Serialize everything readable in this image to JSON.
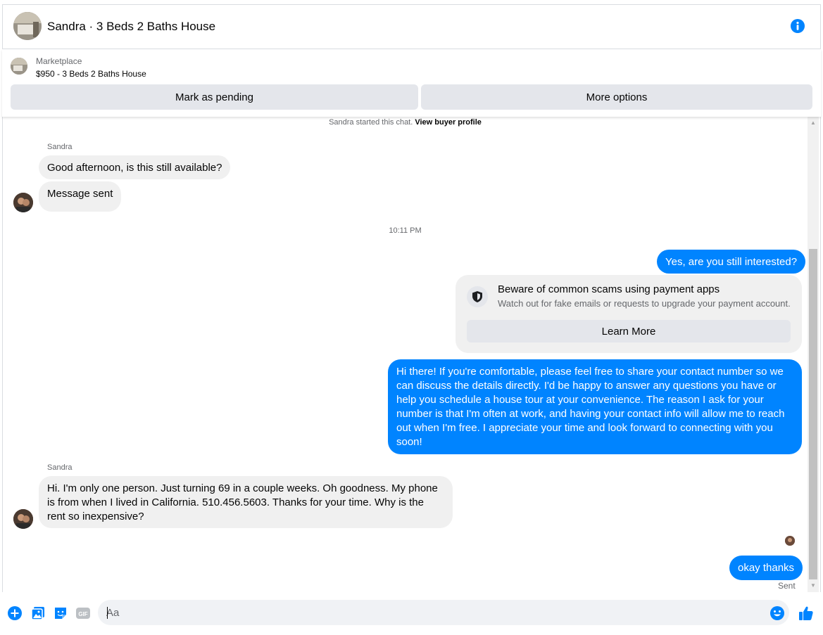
{
  "header": {
    "title": "Sandra · 3 Beds 2 Baths House",
    "info_icon": "info-icon"
  },
  "marketplace": {
    "source": "Marketplace",
    "item": "$950 - 3 Beds 2 Baths House",
    "mark_pending_label": "Mark as pending",
    "more_options_label": "More options"
  },
  "thread": {
    "system_note": "Sandra started this chat.",
    "system_link": "View buyer profile",
    "timestamp": "10:11 PM",
    "messages": [
      {
        "sender": "Sandra",
        "text": "Good afternoon, is this still available?"
      },
      {
        "sender": "Sandra",
        "text": "Message sent"
      },
      {
        "sender": "me",
        "text": "Yes, are you still interested?"
      },
      {
        "sender": "me",
        "text": "Hi there! If you're comfortable, please feel free to share your contact number so we can discuss the details directly. I'd be happy to answer any questions you have or help you schedule a house tour at your convenience. The reason I ask for your number is that I'm often at work, and having your contact info will allow me to reach out when I'm free. I appreciate your time and look forward to connecting with you soon!"
      },
      {
        "sender": "Sandra",
        "text": "Hi. I'm only one person. Just turning 69 in a couple weeks.  Oh goodness. My phone is from when I lived in California. 510.456.5603. Thanks for your time. Why is the rent so inexpensive?"
      },
      {
        "sender": "me",
        "text": "okay thanks"
      }
    ],
    "sender_name_1": "Sandra",
    "sender_name_2": "Sandra",
    "scam_card": {
      "title": "Beware of common scams using payment apps",
      "description": "Watch out for fake emails or requests to upgrade your payment account.",
      "button_label": "Learn More",
      "icon": "shield-icon"
    },
    "sent_status": "Sent"
  },
  "composer": {
    "placeholder": "Aa",
    "icons": [
      "plus-circle-icon",
      "photo-icon",
      "sticker-icon",
      "gif-icon",
      "emoji-icon",
      "thumbs-up-icon"
    ],
    "gif_text": "GIF"
  },
  "colors": {
    "accent": "#0084ff",
    "incoming_bubble": "#f0f0f0",
    "button_gray": "#e4e6eb",
    "muted_text": "#65676b"
  }
}
